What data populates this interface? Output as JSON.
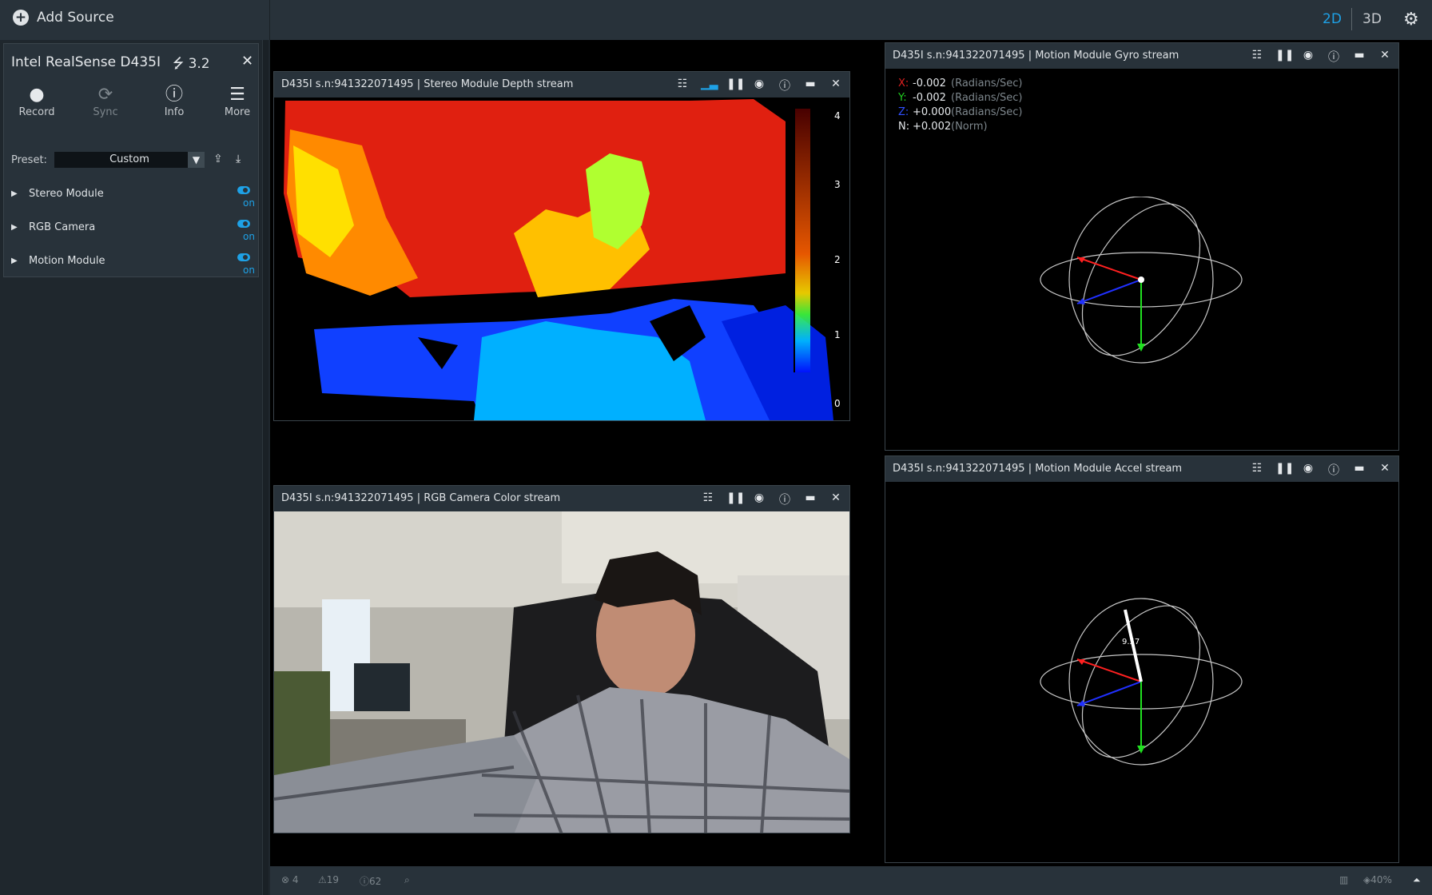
{
  "topbar": {
    "add_source": "Add Source",
    "view_2d": "2D",
    "view_3d": "3D"
  },
  "device": {
    "name": "Intel RealSense D435I",
    "usb": "3.2",
    "actions": [
      {
        "label": "Record",
        "icon": "record-icon"
      },
      {
        "label": "Sync",
        "icon": "sync-icon"
      },
      {
        "label": "Info",
        "icon": "info-icon"
      },
      {
        "label": "More",
        "icon": "menu-icon"
      }
    ],
    "preset_label": "Preset:",
    "preset_value": "Custom",
    "modules": [
      {
        "name": "Stereo Module",
        "state": "on"
      },
      {
        "name": "RGB Camera",
        "state": "on"
      },
      {
        "name": "Motion Module",
        "state": "on"
      }
    ]
  },
  "panels": {
    "depth": {
      "title": "D435I s.n:941322071495 | Stereo Module Depth stream",
      "scale": [
        "4",
        "3",
        "2",
        "1",
        "0"
      ]
    },
    "color": {
      "title": "D435I s.n:941322071495 | RGB Camera Color stream"
    },
    "gyro": {
      "title": "D435I s.n:941322071495 | Motion Module Gyro stream",
      "readings": [
        {
          "axis": "X:",
          "value": "-0.002",
          "unit": "(Radians/Sec)",
          "color": "#e02020"
        },
        {
          "axis": "Y:",
          "value": "-0.002",
          "unit": "(Radians/Sec)",
          "color": "#20d020"
        },
        {
          "axis": "Z:",
          "value": "+0.000",
          "unit": "(Radians/Sec)",
          "color": "#3050ff"
        },
        {
          "axis": "N:",
          "value": "+0.002",
          "unit": "(Norm)",
          "color": "#e6e9ec"
        }
      ]
    },
    "accel": {
      "title": "D435I s.n:941322071495 | Motion Module Accel stream",
      "norm_label": "9.57"
    }
  },
  "status": {
    "errors": "4",
    "warnings": "19",
    "info": "62",
    "zoom": "40%"
  }
}
